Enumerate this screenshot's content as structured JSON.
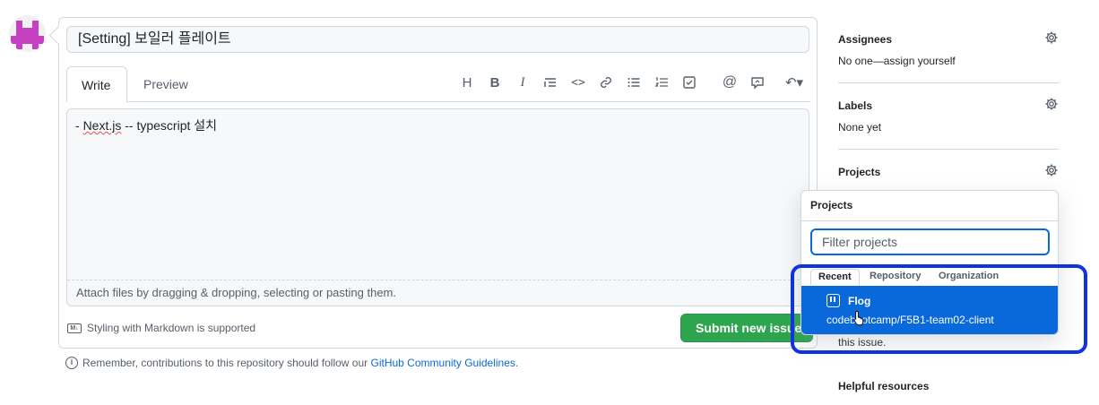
{
  "issue": {
    "title_value": "[Setting] 보일러 플레이트",
    "body_text_prefix": "- ",
    "body_text_word": "Next.js",
    "body_text_suffix": " -- typescript 설치"
  },
  "editor": {
    "tabs": [
      {
        "label": "Write",
        "active": true
      },
      {
        "label": "Preview",
        "active": false
      }
    ],
    "toolbar_icons": [
      "heading-icon",
      "bold-icon",
      "italic-icon",
      "quote-icon",
      "code-icon",
      "link-icon",
      "bulleted-list-icon",
      "numbered-list-icon",
      "task-list-icon",
      "mention-icon",
      "reference-icon",
      "reply-icon"
    ],
    "toolbar_glyphs": {
      "heading": "H",
      "bold": "B",
      "italic": "I",
      "code": "<>",
      "mention": "@",
      "reply": "↶▾"
    },
    "attach_text": "Attach files by dragging & dropping, selecting or pasting them."
  },
  "footer": {
    "markdown_icon_text": "M↓",
    "markdown_note": "Styling with Markdown is supported",
    "submit_label": "Submit new issue",
    "info_icon_text": "i",
    "guidelines_prefix": "Remember, contributions to this repository should follow our ",
    "guidelines_link": "GitHub Community Guidelines",
    "guidelines_suffix": "."
  },
  "sidebar": {
    "assignees": {
      "title": "Assignees",
      "value": "No one—assign yourself"
    },
    "labels": {
      "title": "Labels",
      "value": "None yet"
    },
    "projects": {
      "title": "Projects"
    },
    "issue_text": "this issue.",
    "helpful_title": "Helpful resources"
  },
  "projects_popover": {
    "title": "Projects",
    "filter_placeholder": "Filter projects",
    "tabs": [
      {
        "label": "Recent",
        "active": true
      },
      {
        "label": "Repository",
        "active": false
      },
      {
        "label": "Organization",
        "active": false
      }
    ],
    "item": {
      "name": "Flog",
      "owner": "codebootcamp/F5B1-team02-client"
    }
  },
  "colors": {
    "accent": "#0969da",
    "submit": "#2da44e",
    "highlight": "#1133dd",
    "avatar": "#c640c2"
  }
}
